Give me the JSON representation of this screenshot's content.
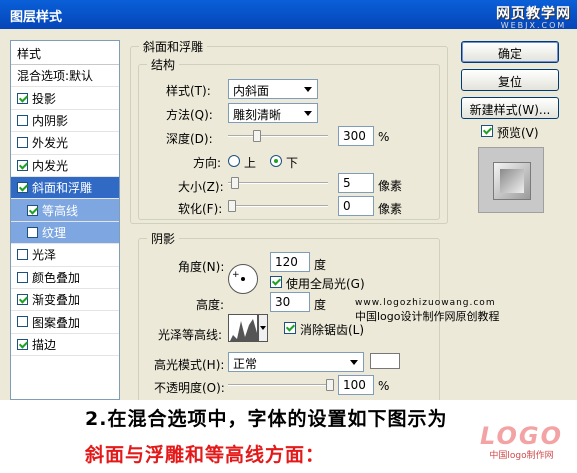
{
  "window": {
    "title": "图层样式"
  },
  "watermark_top": {
    "line1": "网页教学网",
    "line2": "WEBJX.COM"
  },
  "style_list": {
    "header": "样式",
    "blend_options": "混合选项:默认",
    "items": [
      {
        "label": "投影",
        "checked": true
      },
      {
        "label": "内阴影",
        "checked": false
      },
      {
        "label": "外发光",
        "checked": false
      },
      {
        "label": "内发光",
        "checked": true
      },
      {
        "label": "斜面和浮雕",
        "checked": true,
        "selected": true
      },
      {
        "label": "等高线",
        "checked": true,
        "sub": true
      },
      {
        "label": "纹理",
        "checked": false,
        "sub": true
      },
      {
        "label": "光泽",
        "checked": false
      },
      {
        "label": "颜色叠加",
        "checked": false
      },
      {
        "label": "渐变叠加",
        "checked": true
      },
      {
        "label": "图案叠加",
        "checked": false
      },
      {
        "label": "描边",
        "checked": true
      }
    ]
  },
  "bevel": {
    "group_title": "斜面和浮雕",
    "structure_title": "结构",
    "style_label": "样式(T):",
    "style_value": "内斜面",
    "technique_label": "方法(Q):",
    "technique_value": "雕刻清晰",
    "depth_label": "深度(D):",
    "depth_value": "300",
    "depth_unit": "%",
    "depth_level": 0.27,
    "direction_label": "方向:",
    "dir_up": "上",
    "dir_down": "下",
    "direction_selected": "下",
    "size_label": "大小(Z):",
    "size_value": "5",
    "size_unit": "像素",
    "size_level": 0.03,
    "soften_label": "软化(F):",
    "soften_value": "0",
    "soften_unit": "像素",
    "soften_level": 0.0
  },
  "shading": {
    "title": "阴影",
    "angle_label": "角度(N):",
    "angle_value": "120",
    "angle_unit": "度",
    "global_light_label": "使用全局光(G)",
    "global_light_checked": true,
    "altitude_label": "高度:",
    "altitude_value": "30",
    "altitude_unit": "度",
    "gloss_contour_label": "光泽等高线:",
    "antialias_label": "消除锯齿(L)",
    "antialias_checked": true,
    "highlight_mode_label": "高光模式(H):",
    "highlight_mode_value": "正常",
    "opacity_label": "不透明度(O):",
    "opacity_value": "100",
    "opacity_unit": "%",
    "opacity_level": 1.0
  },
  "buttons": {
    "ok": "确定",
    "reset": "复位",
    "new_style": "新建样式(W)...",
    "preview_label": "预览(V)",
    "preview_checked": true
  },
  "watermark_mid": {
    "line1": "www.logozhizuowang.com",
    "line2": "中国logo设计制作网原创教程"
  },
  "banner": {
    "line1": "2.在混合选项中，字体的设置如下图示为",
    "line2": "斜面与浮雕和等高线方面：",
    "logo_big": "LOGO",
    "logo_small": "中国logo制作网"
  },
  "colors": {
    "selection": "#316ac5",
    "title_bar": "#0a5fd8",
    "highlight_text": "#e41a1a"
  }
}
